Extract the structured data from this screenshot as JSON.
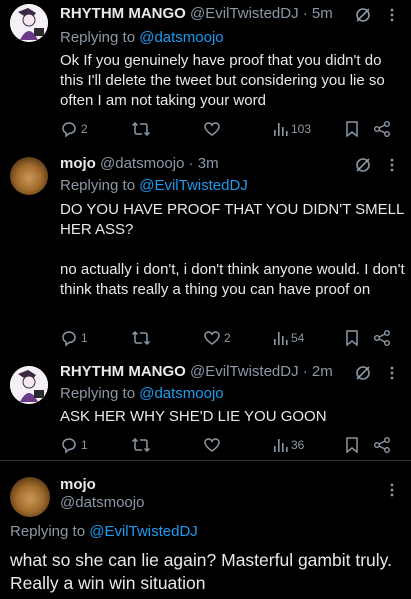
{
  "tweets": [
    {
      "name": "RHYTHM MANGO",
      "handle": "@EvilTwistedDJ",
      "time": "· 5m",
      "replying_prefix": "Replying to",
      "replying_handle": "@datsmoojo",
      "body": "Ok If you genuinely have proof that you didn't do this I'll delete the tweet but considering you lie so often  I am not taking your word",
      "replies": "2",
      "retweets": "",
      "likes": "",
      "views": "103"
    },
    {
      "name": "mojo",
      "handle": "@datsmoojo",
      "time": "· 3m",
      "replying_prefix": "Replying to",
      "replying_handle": "@EvilTwistedDJ",
      "body_p1": "DO YOU HAVE PROOF THAT YOU DIDN'T SMELL HER ASS?",
      "body_p2": "no actually i don't, i don't think anyone would. I don't think thats really a thing you can have proof on",
      "replies": "1",
      "retweets": "",
      "likes": "2",
      "views": "54"
    },
    {
      "name": "RHYTHM MANGO",
      "handle": "@EvilTwistedDJ",
      "time": "· 2m",
      "replying_prefix": "Replying to",
      "replying_handle": "@datsmoojo",
      "body": "ASK HER WHY SHE'D LIE YOU GOON",
      "replies": "1",
      "retweets": "",
      "likes": "",
      "views": "36"
    }
  ],
  "main_tweet": {
    "name": "mojo",
    "handle": "@datsmoojo",
    "replying_prefix": "Replying to",
    "replying_handle": "@EvilTwistedDJ",
    "body": "what so she can lie again? Masterful gambit truly. Really a win win situation"
  },
  "colors": {
    "background": "#000000",
    "text": "#e7e9ea",
    "muted": "#8b98a5",
    "link": "#1d9bf0"
  },
  "icons": [
    "reply-icon",
    "retweet-icon",
    "like-icon",
    "views-icon",
    "bookmark-icon",
    "share-icon",
    "grok-icon",
    "more-icon"
  ]
}
